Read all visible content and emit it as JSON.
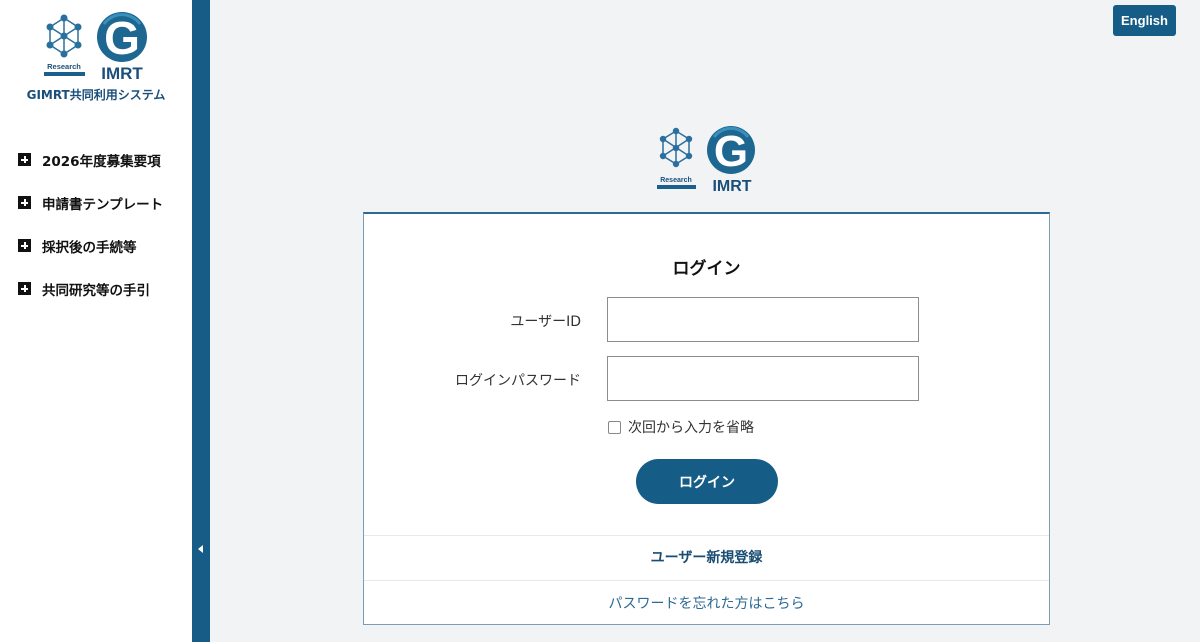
{
  "sidebar": {
    "logo": {
      "badge_text": "Research",
      "brand_text": "IMRT",
      "letter": "G"
    },
    "system_name": "GIMRT共同利用システム",
    "items": [
      {
        "label": "2026年度募集要項",
        "icon": "plus-square-icon"
      },
      {
        "label": "申請書テンプレート",
        "icon": "plus-square-icon"
      },
      {
        "label": "採択後の手続等",
        "icon": "plus-square-icon"
      },
      {
        "label": "共同研究等の手引",
        "icon": "plus-square-icon"
      }
    ]
  },
  "header": {
    "language_button": "English"
  },
  "center_logo": {
    "badge_text": "Research",
    "brand_text": "IMRT",
    "letter": "G"
  },
  "login": {
    "title": "ログイン",
    "user_id_label": "ユーザーID",
    "user_id_value": "",
    "password_label": "ログインパスワード",
    "password_value": "",
    "remember_label": "次回から入力を省略",
    "remember_checked": false,
    "submit_label": "ログイン",
    "register_link": "ユーザー新規登録",
    "forgot_link": "パスワードを忘れた方はこちら"
  },
  "colors": {
    "primary": "#155d86",
    "sidebar_bar": "#165c86",
    "background": "#f2f3f5",
    "link": "#2e6a92"
  }
}
